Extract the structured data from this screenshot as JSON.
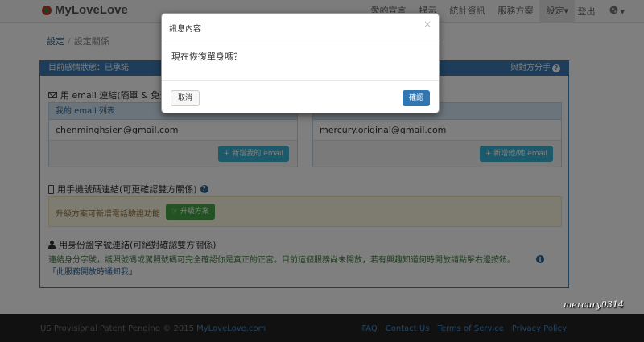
{
  "navbar": {
    "brand": "MyLoveLove",
    "items": [
      "愛的宣言",
      "提示",
      "統計資訊",
      "服務方案",
      "設定"
    ],
    "settings_caret": "▾",
    "logout": "登出",
    "globe_caret": "▾"
  },
  "breadcrumb": {
    "root": "設定",
    "separator": "/",
    "current": "設定關係"
  },
  "panel": {
    "status": "目前感情狀態：已承諾",
    "breakup": "與對方分手",
    "email_section": {
      "title": "用 email 連結(簡單 & 免費)",
      "left": {
        "header": "我的 email 列表",
        "email": "chenminghsien@gmail.com",
        "button": "+ 新增我的 email"
      },
      "right": {
        "email": "mercury.original@gmail.com",
        "button": "+ 新增他/她 email"
      }
    },
    "phone_section": {
      "title": "用手機號碼連結(可更確認雙方關係)",
      "upgrade_text": "升級方案可新增電話驗證功能",
      "upgrade_button": "☞ 升級方案"
    },
    "id_section": {
      "title": "用身份證字號連結(可絕對確認雙方關係)",
      "description": "連結身分字號，護照號碼或駕照號碼可完全確認你是真正的正宮。目前這個服務尚未開放，若有興趣知道何時開放請點擊右邊按鈕。",
      "notify_link": "「此服務開放時通知我」"
    }
  },
  "footer": {
    "copyright": "US Provisional Patent Pending © 2015 ",
    "site": "MyLoveLove.com",
    "links": [
      "FAQ",
      "Contact Us",
      "Terms of Service",
      "Privacy Policy"
    ]
  },
  "watermark": "mercury0314",
  "modal": {
    "title": "訊息內容",
    "close": "×",
    "message": "現在恢復單身嗎？",
    "cancel": "取消",
    "confirm": "確認"
  }
}
